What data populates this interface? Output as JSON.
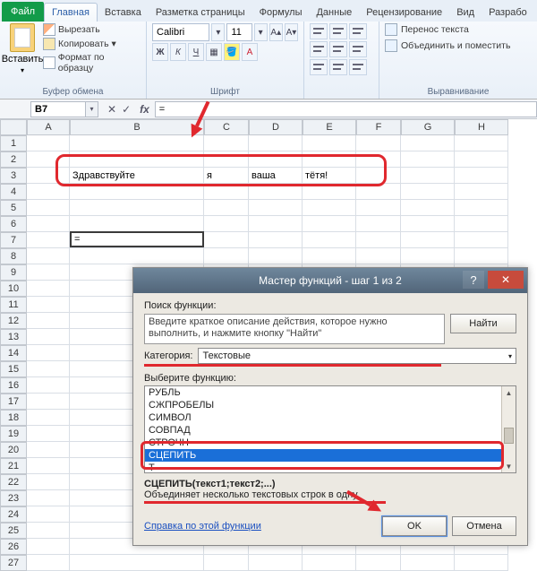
{
  "tabs": {
    "file": "Файл",
    "home": "Главная",
    "insert": "Вставка",
    "layout": "Разметка страницы",
    "formulas": "Формулы",
    "data": "Данные",
    "review": "Рецензирование",
    "view": "Вид",
    "dev": "Разрабо"
  },
  "clipboard": {
    "paste": "Вставить",
    "cut": "Вырезать",
    "copy": "Копировать",
    "format": "Формат по образцу",
    "group": "Буфер обмена"
  },
  "font": {
    "name": "Calibri",
    "size": "11",
    "group": "Шрифт"
  },
  "align": {
    "wrap": "Перенос текста",
    "merge": "Объединить и поместить",
    "group": "Выравнивание"
  },
  "formula_bar": {
    "cellref": "B7",
    "value": "="
  },
  "cols": [
    "A",
    "B",
    "C",
    "D",
    "E",
    "F",
    "G",
    "H"
  ],
  "cells": {
    "b3": "Здравствуйте",
    "c3": "я",
    "d3": "ваша",
    "e3": "тётя!",
    "b7": "="
  },
  "dialog": {
    "title": "Мастер функций - шаг 1 из 2",
    "search_label": "Поиск функции:",
    "search_placeholder": "Введите краткое описание действия, которое нужно выполнить, и нажмите кнопку \"Найти\"",
    "find": "Найти",
    "category_label": "Категория:",
    "category_value": "Текстовые",
    "select_label": "Выберите функцию:",
    "functions": [
      "РУБЛЬ",
      "СЖПРОБЕЛЫ",
      "СИМВОЛ",
      "СОВПАД",
      "СТРОЧН",
      "СЦЕПИТЬ",
      "Т"
    ],
    "selected": "СЦЕПИТЬ",
    "sig": "СЦЕПИТЬ(текст1;текст2;...)",
    "desc": "Объединяет несколько текстовых строк в одну.",
    "help": "Справка по этой функции",
    "ok": "OK",
    "cancel": "Отмена"
  }
}
